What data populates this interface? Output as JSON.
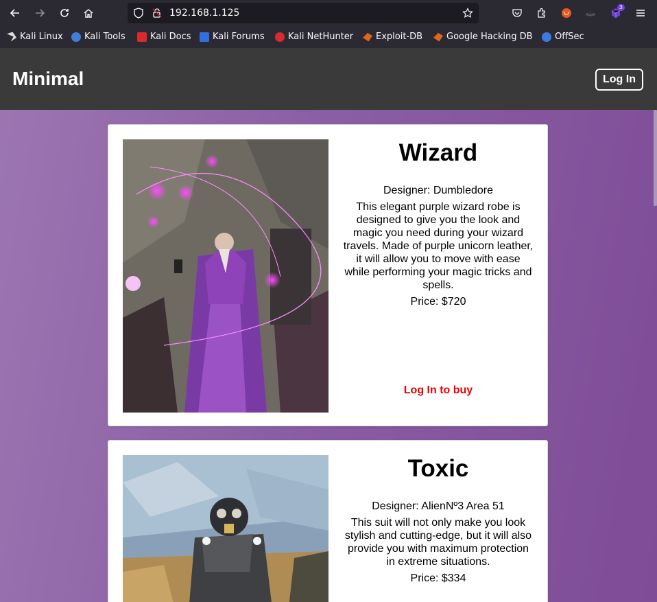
{
  "browser": {
    "url": "192.168.1.125",
    "extensions_badge": "3",
    "bookmarks": [
      {
        "label": "Kali Linux",
        "icon": "kali-dragon-icon",
        "color": "#dddddd"
      },
      {
        "label": "Kali Tools",
        "icon": "kali-tools-icon",
        "color": "#3f7fd9"
      },
      {
        "label": "Kali Docs",
        "icon": "kali-docs-icon",
        "color": "#d92b2b"
      },
      {
        "label": "Kali Forums",
        "icon": "kali-forums-icon",
        "color": "#2f6fe0"
      },
      {
        "label": "Kali NetHunter",
        "icon": "kali-nethunter-icon",
        "color": "#d92b2b"
      },
      {
        "label": "Exploit-DB",
        "icon": "exploit-db-icon",
        "color": "#e0651f"
      },
      {
        "label": "Google Hacking DB",
        "icon": "ghdb-icon",
        "color": "#e0651f"
      },
      {
        "label": "OffSec",
        "icon": "offsec-icon",
        "color": "#3a7be0"
      }
    ]
  },
  "site": {
    "brand": "Minimal",
    "login_label": "Log In"
  },
  "products": [
    {
      "name": "Wizard",
      "designer": "Designer: Dumbledore",
      "description": "This elegant purple wizard robe is designed to give you the look and magic you need during your wizard travels. Made of purple unicorn leather, it will allow you to move with ease while performing your magic tricks and spells.",
      "price": "Price: $720",
      "buy_label": "Log In to buy"
    },
    {
      "name": "Toxic",
      "designer": "Designer: AlienNº3 Area 51",
      "description": "This suit will not only make you look stylish and cutting-edge, but it will also provide you with maximum protection in extreme situations.",
      "price": "Price: $334"
    }
  ],
  "colors": {
    "header_bg": "#3a3a3a",
    "buy_link": "#ee0000",
    "page_gradient_start": "#9c76b1",
    "page_gradient_end": "#7f4c97"
  }
}
